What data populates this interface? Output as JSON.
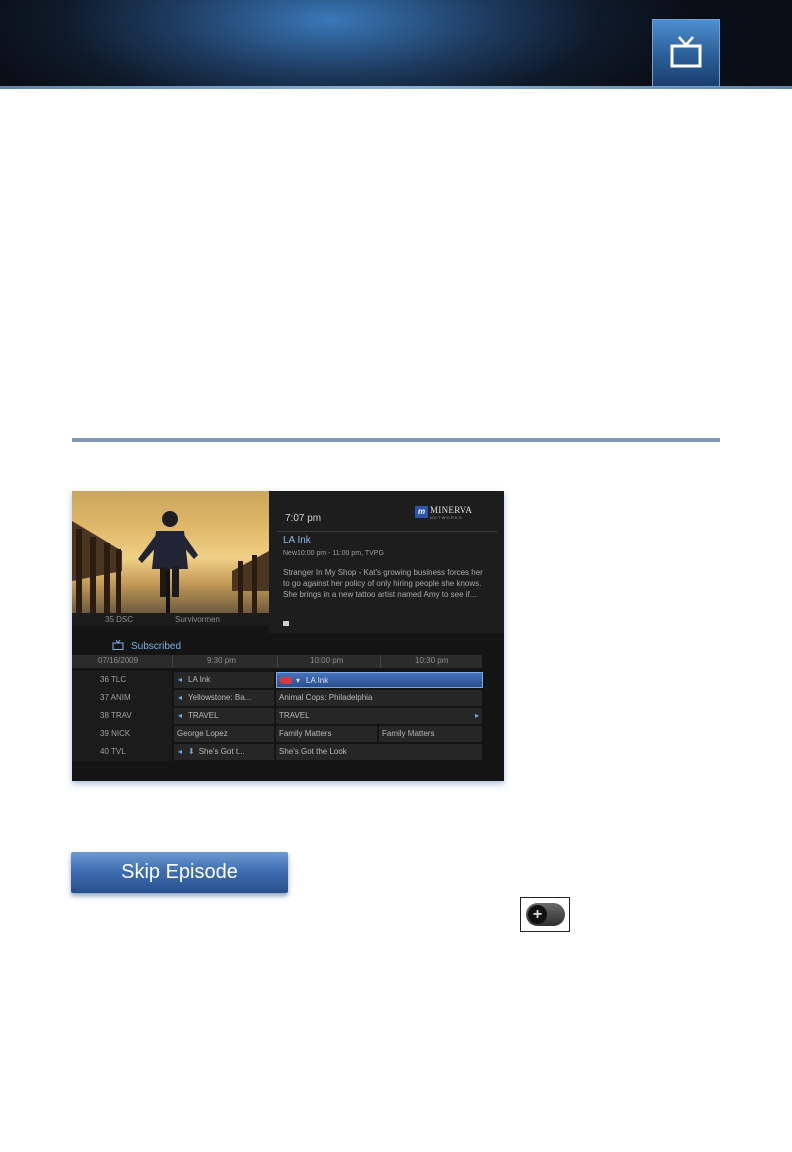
{
  "guide": {
    "preview": {
      "channel": "35  DSC",
      "program": "Survivormen"
    },
    "info": {
      "time": "7:07 pm",
      "logo_badge": "m",
      "logo_word": "MINERVA",
      "logo_sub": "NETWORKS",
      "title": "LA Ink",
      "meta": "New10:00 pm - 11:00 pm, TVPG",
      "description": "Stranger In My Shop - Kat's growing business forces her to go against her policy of only hiring people she knows. She brings in a new tattoo artist named Amy to see if..."
    },
    "filter_label": "Subscribed",
    "date": "07/16/2009",
    "times": [
      "9:30 pm",
      "10:00 pm",
      "10:30 pm"
    ],
    "rows": [
      {
        "channel": "36 TLC",
        "c1": "LA Ink",
        "c2": "LA Ink"
      },
      {
        "channel": "37 ANIM",
        "c1": "Yellowstone: Ba...",
        "c2": "Animal Cops: Philadelphia"
      },
      {
        "channel": "38 TRAV",
        "c1": "TRAVEL",
        "c2": "TRAVEL"
      },
      {
        "channel": "39 NICK",
        "c1": "George Lopez",
        "c2": "Family Matters",
        "c3": "Family Matters"
      },
      {
        "channel": "40 TVL",
        "c1": "She's Got t...",
        "c2": "She's Got the Look"
      }
    ]
  },
  "skip_button": {
    "label": "Skip Episode"
  },
  "icons": {
    "header": "tv-icon",
    "remote_key": "plus-key-icon"
  }
}
